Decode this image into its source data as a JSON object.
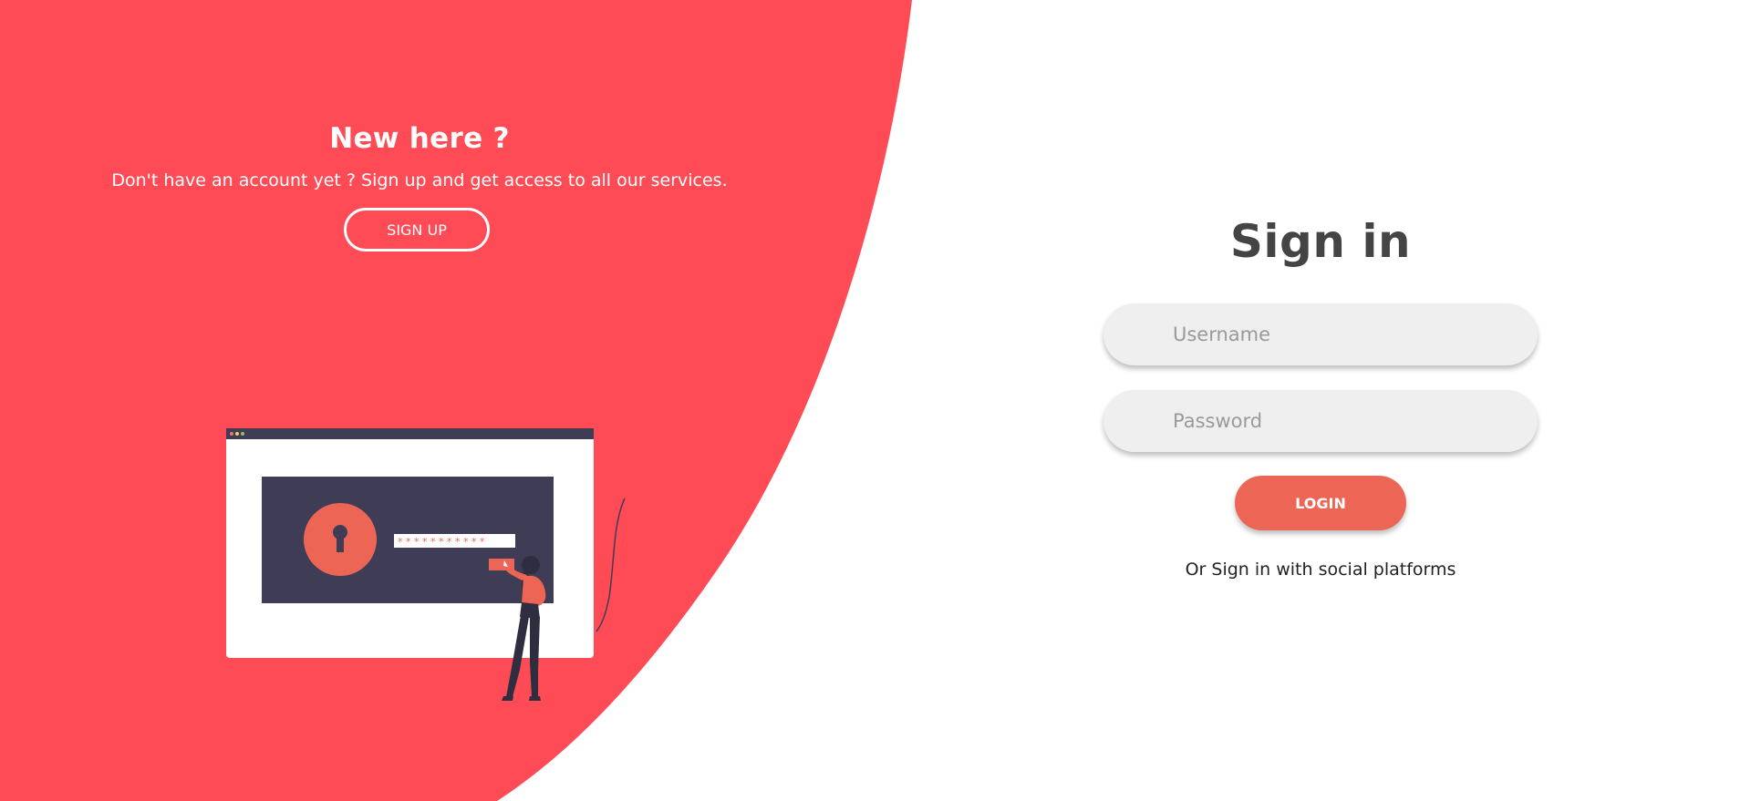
{
  "colors": {
    "accent_red": "#ff4b55",
    "login_button": "#ec6555",
    "title_dark": "#444444",
    "field_bg": "#efefef"
  },
  "left_panel": {
    "title": "New here ?",
    "description": "Don't have an account yet ? Sign up and get access to all our services.",
    "signup_label": "SIGN UP",
    "illustration_icon": "lock-screen-illustration"
  },
  "signin_form": {
    "title": "Sign in",
    "username_placeholder": "Username",
    "password_placeholder": "Password",
    "login_label": "LOGIN",
    "social_text": "Or Sign in with social platforms"
  }
}
